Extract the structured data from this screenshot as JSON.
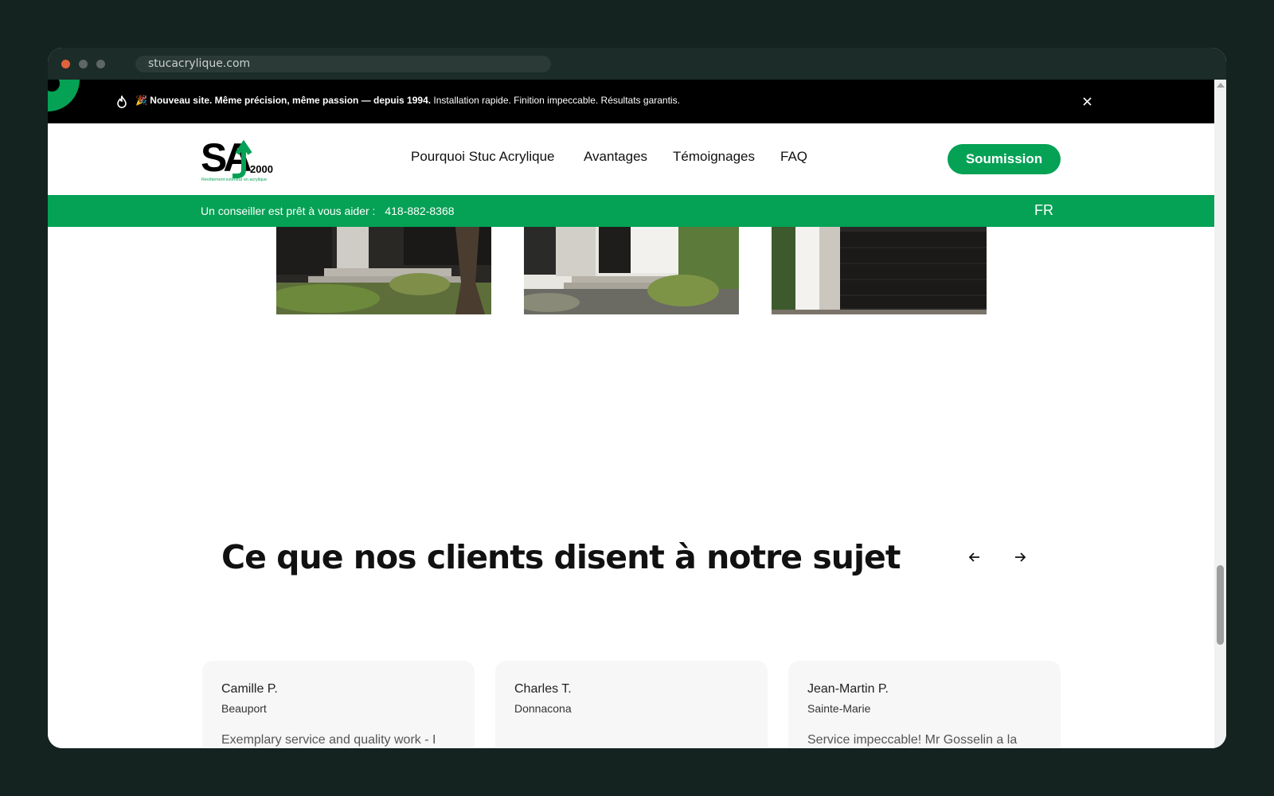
{
  "browser": {
    "url": "stucacrylique.com"
  },
  "announcement": {
    "emoji": "🎉",
    "bold_text": "Nouveau site. Même précision, même passion — depuis 1994.",
    "text": " Installation rapide. Finition impeccable. Résultats garantis."
  },
  "logo": {
    "letters": "SA",
    "year": "2000",
    "tagline": "Revêtement extérieur en acrylique"
  },
  "nav": {
    "items": [
      {
        "label": "Pourquoi Stuc Acrylique"
      },
      {
        "label": "Avantages"
      },
      {
        "label": "Témoignages"
      },
      {
        "label": "FAQ"
      }
    ],
    "cta_label": "Soumission"
  },
  "contact_bar": {
    "advisor_text": "Un conseiller est prêt à vous aider :",
    "phone": "418-882-8368",
    "language": "FR"
  },
  "testimonials": {
    "title": "Ce que nos clients disent à notre sujet",
    "items": [
      {
        "name": "Camille P.",
        "city": "Beauport",
        "excerpt": "Exemplary service and quality work - I"
      },
      {
        "name": "Charles T.",
        "city": "Donnacona",
        "excerpt": ""
      },
      {
        "name": "Jean-Martin P.",
        "city": "Sainte-Marie",
        "excerpt": "Service impeccable! Mr Gosselin a la"
      }
    ]
  },
  "colors": {
    "accent_green": "#05a155",
    "announcement_bg": "#000000",
    "page_bg": "#142320"
  }
}
